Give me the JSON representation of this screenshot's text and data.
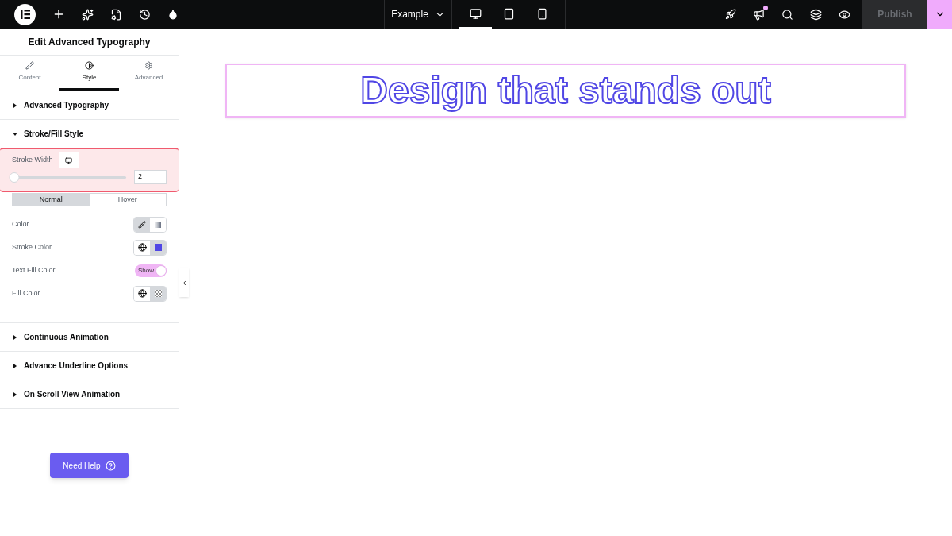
{
  "topbar": {
    "page": "Example",
    "publish": "Publish",
    "devices": [
      {
        "kind": "desktop",
        "selected": true
      },
      {
        "kind": "tablet",
        "selected": false
      },
      {
        "kind": "mobile",
        "selected": false
      }
    ],
    "notification": true
  },
  "panel": {
    "title": "Edit Advanced Typography",
    "tabs": [
      {
        "label": "Content",
        "kind": "pencil",
        "selected": false
      },
      {
        "label": "Style",
        "kind": "contrast",
        "selected": true
      },
      {
        "label": "Advanced",
        "kind": "gear",
        "selected": false
      }
    ],
    "sections": [
      {
        "title": "Advanced Typography",
        "expanded": false
      },
      {
        "title": "Stroke/Fill Style",
        "expanded": true,
        "stroke_width": {
          "label": "Stroke Width",
          "value": "2",
          "level": 0.02,
          "highlighted": true
        },
        "states": [
          {
            "label": "Normal",
            "selected": true
          },
          {
            "label": "Hover",
            "selected": false
          }
        ],
        "controls": [
          {
            "kind": "color-type",
            "label": "Color"
          },
          {
            "kind": "color-picker",
            "label": "Stroke Color",
            "color": "#5046e5"
          },
          {
            "kind": "toggle",
            "label": "Text Fill Color",
            "toggle_label": "Show",
            "on": true
          },
          {
            "kind": "color-picker",
            "label": "Fill Color"
          }
        ]
      },
      {
        "title": "Continuous Animation",
        "expanded": false
      },
      {
        "title": "Advance Underline Options",
        "expanded": false
      },
      {
        "title": "On Scroll View Animation",
        "expanded": false
      }
    ],
    "help": "Need Help"
  },
  "canvas": {
    "heading": "Design that stands out",
    "selected": true
  }
}
